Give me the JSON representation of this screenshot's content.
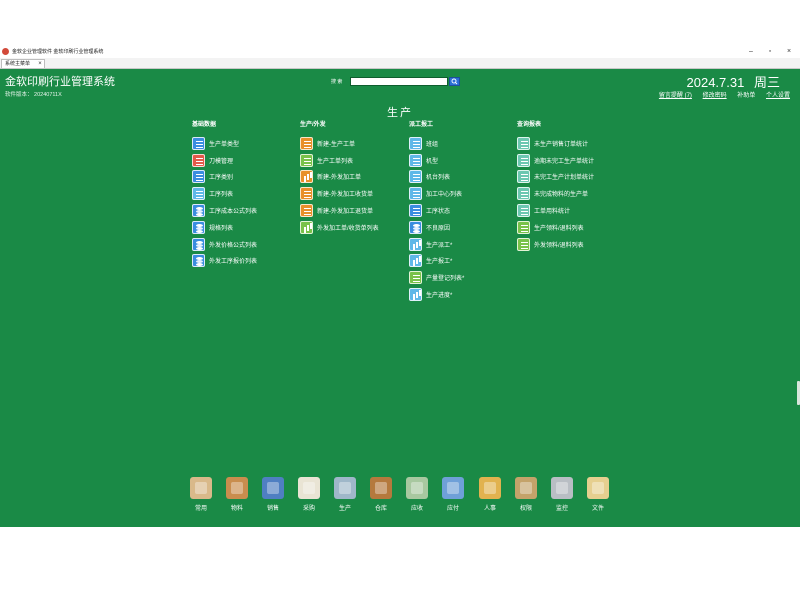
{
  "window": {
    "title": "金软企业管理软件 金软印刷行业管理系统",
    "minimize": "–",
    "maximize": "▫",
    "close": "×"
  },
  "tabs": [
    {
      "label": "系统主菜单",
      "close": "×"
    }
  ],
  "header": {
    "system_title": "金软印刷行业管理系统",
    "version_label": "软件版本：",
    "version_value": "20240711X",
    "search_label": "搜 索",
    "search_value": "",
    "search_placeholder": "",
    "date": "2024.7.31",
    "weekday": "周三",
    "links": {
      "messages": "留言提醒 (7)",
      "password": "修改密码",
      "user": "补助单",
      "personal": "个人设置"
    }
  },
  "section_title": "生产",
  "columns": [
    {
      "heading": "基础数据",
      "items": [
        {
          "label": "生产单类型",
          "icon": "list-icon"
        },
        {
          "label": "刀模管理",
          "icon": "knife-icon"
        },
        {
          "label": "工序类别",
          "icon": "list-icon"
        },
        {
          "label": "工序列表",
          "icon": "worker-icon"
        },
        {
          "label": "工序成本公式列表",
          "icon": "database-icon"
        },
        {
          "label": "规格列表",
          "icon": "database-icon"
        },
        {
          "label": "外发价格公式列表",
          "icon": "database-icon"
        },
        {
          "label": "外发工序报价列表",
          "icon": "database-icon"
        }
      ]
    },
    {
      "heading": "生产/外发",
      "items": [
        {
          "label": "新建-生产工单",
          "icon": "new-order-icon"
        },
        {
          "label": "生产工单列表",
          "icon": "order-list-icon"
        },
        {
          "label": "新建-外发加工单",
          "icon": "outsource-icon"
        },
        {
          "label": "新建-外发加工收货单",
          "icon": "receive-icon"
        },
        {
          "label": "新建-外发加工退货单",
          "icon": "return-icon"
        },
        {
          "label": "外发加工单/收货单列表",
          "icon": "chart-icon"
        }
      ]
    },
    {
      "heading": "派工报工",
      "items": [
        {
          "label": "班组",
          "icon": "team-icon"
        },
        {
          "label": "机型",
          "icon": "machine-icon"
        },
        {
          "label": "机台列表",
          "icon": "machine-icon"
        },
        {
          "label": "加工中心列表",
          "icon": "worker-icon"
        },
        {
          "label": "工序状态",
          "icon": "list-icon"
        },
        {
          "label": "不良原因",
          "icon": "database-icon"
        },
        {
          "label": "生产派工*",
          "icon": "chart-icon"
        },
        {
          "label": "生产报工*",
          "icon": "chart-icon"
        },
        {
          "label": "产量登记列表*",
          "icon": "register-icon"
        },
        {
          "label": "生产进度*",
          "icon": "chart-icon"
        }
      ]
    },
    {
      "heading": "查询报表",
      "items": [
        {
          "label": "未生产销售订单统计",
          "icon": "report-icon"
        },
        {
          "label": "逾期未完工生产单统计",
          "icon": "report-icon"
        },
        {
          "label": "未完工生产计划单统计",
          "icon": "report-icon"
        },
        {
          "label": "未完成物料的生产单",
          "icon": "report-icon"
        },
        {
          "label": "工单用料统计",
          "icon": "report-icon"
        },
        {
          "label": "生产领料/退料列表",
          "icon": "material-icon"
        },
        {
          "label": "外发领料/退料列表",
          "icon": "material-icon"
        }
      ]
    }
  ],
  "dock": [
    {
      "label": "常用",
      "icon": "map-icon",
      "color": "#d9b98a"
    },
    {
      "label": "物料",
      "icon": "boxes-icon",
      "color": "#c98d4e"
    },
    {
      "label": "销售",
      "icon": "sales-chart-icon",
      "color": "#4f7fc2"
    },
    {
      "label": "采购",
      "icon": "clipboard-icon",
      "color": "#e9e4d4"
    },
    {
      "label": "生产",
      "icon": "folder-clock-icon",
      "color": "#9fb7c9"
    },
    {
      "label": "仓库",
      "icon": "crate-icon",
      "color": "#b5793d"
    },
    {
      "label": "应收",
      "icon": "receivable-icon",
      "color": "#a8c8a0"
    },
    {
      "label": "应付",
      "icon": "payable-icon",
      "color": "#6fa0d8"
    },
    {
      "label": "人事",
      "icon": "person-icon",
      "color": "#e1b24f"
    },
    {
      "label": "权限",
      "icon": "key-icon",
      "color": "#c4a36a"
    },
    {
      "label": "监控",
      "icon": "camera-icon",
      "color": "#b9bec4"
    },
    {
      "label": "文件",
      "icon": "file-icon",
      "color": "#e6cf8f"
    }
  ],
  "colors": {
    "workspace": "#1a8a46",
    "text": "#ffffff"
  }
}
